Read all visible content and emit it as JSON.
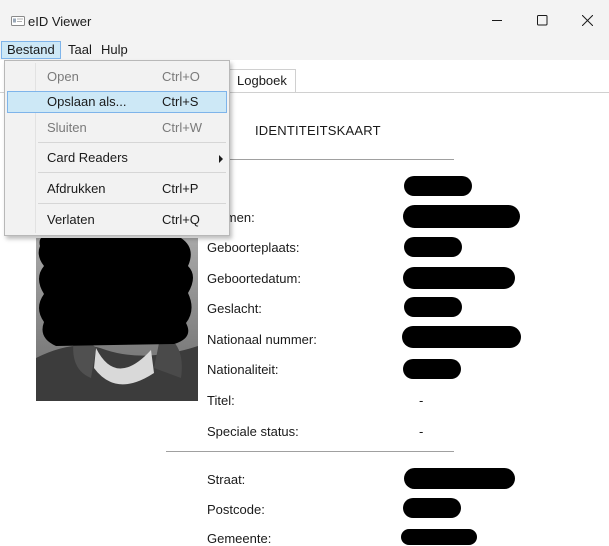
{
  "window": {
    "title": "eID Viewer",
    "icon": "eid-card-icon",
    "controls": [
      "minimize-icon",
      "maximize-icon",
      "close-icon"
    ]
  },
  "menubar": {
    "items": [
      {
        "label": "Bestand",
        "active": true
      },
      {
        "label": "Taal"
      },
      {
        "label": "Hulp"
      }
    ]
  },
  "file_menu": {
    "items": [
      {
        "label": "Open",
        "shortcut": "Ctrl+O",
        "enabled": false
      },
      {
        "label": "Opslaan als...",
        "shortcut": "Ctrl+S",
        "enabled": true,
        "highlighted": true
      },
      {
        "label": "Sluiten",
        "shortcut": "Ctrl+W",
        "enabled": false
      },
      {
        "label": "Card Readers",
        "shortcut": "",
        "submenu": true
      },
      {
        "label": "Afdrukken",
        "shortcut": "Ctrl+P"
      },
      {
        "label": "Verlaten",
        "shortcut": "Ctrl+Q"
      }
    ]
  },
  "tabs": {
    "logboek": "Logboek"
  },
  "card": {
    "title": "IDENTITEITSKAART",
    "fields": [
      {
        "label": "m:",
        "value": "",
        "redacted": true
      },
      {
        "label": "rnamen:",
        "value": "",
        "redacted": true
      },
      {
        "label": "Geboorteplaats:",
        "value": "",
        "redacted": true
      },
      {
        "label": "Geboortedatum:",
        "value": "",
        "redacted": true
      },
      {
        "label": "Geslacht:",
        "value": "",
        "redacted": true
      },
      {
        "label": "Nationaal nummer:",
        "value": "",
        "redacted": true
      },
      {
        "label": "Nationaliteit:",
        "value": "",
        "redacted": true
      },
      {
        "label": "Titel:",
        "value": "-",
        "redacted": false
      },
      {
        "label": "Speciale status:",
        "value": "-",
        "redacted": false
      }
    ],
    "address": [
      {
        "label": "Straat:",
        "value": "",
        "redacted": true
      },
      {
        "label": "Postcode:",
        "value": "",
        "redacted": true
      },
      {
        "label": "Gemeente:",
        "value": "",
        "redacted": true
      }
    ]
  },
  "colors": {
    "titlebar": "#f3f3f3",
    "highlight": "#cde8f6",
    "highlight_border": "#7eb4ea",
    "redaction": "#000000"
  }
}
